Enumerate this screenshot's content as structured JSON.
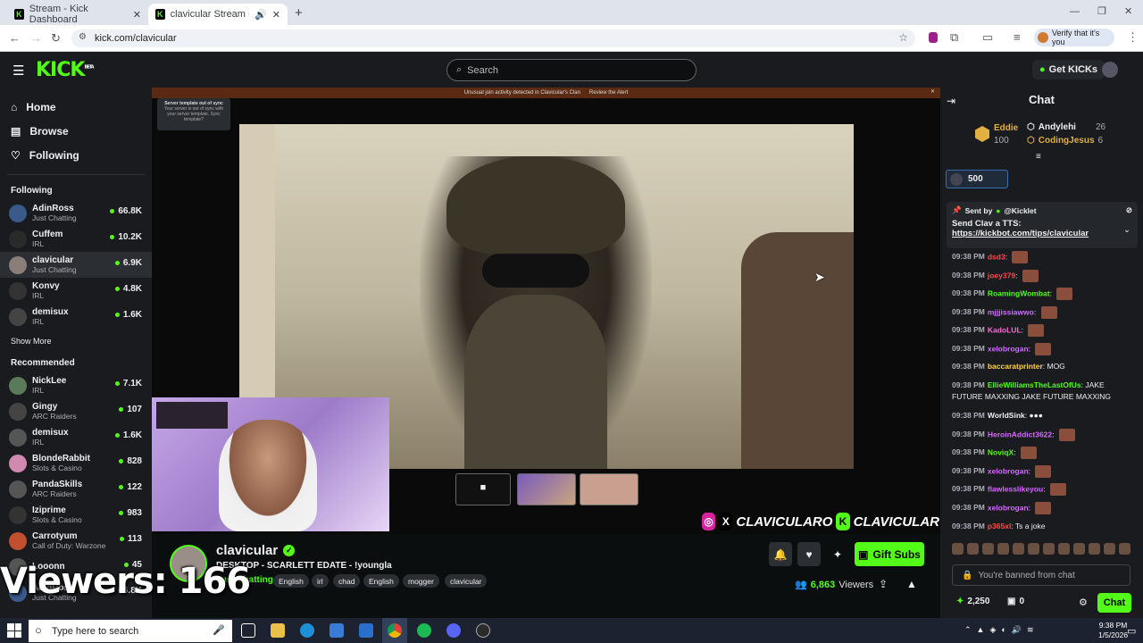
{
  "browser": {
    "tabs": [
      {
        "title": "Stream - Kick Dashboard"
      },
      {
        "title": "clavicular Stream - Watch L"
      }
    ],
    "url": "kick.com/clavicular",
    "verify_label": "Verify that it's you"
  },
  "topnav": {
    "logo": "KICK",
    "logo_badge": "BETA",
    "search_placeholder": "Search",
    "get_kicks_label": "Get KICKs"
  },
  "sidebar": {
    "nav": [
      {
        "label": "Home"
      },
      {
        "label": "Browse"
      },
      {
        "label": "Following"
      }
    ],
    "following_heading": "Following",
    "following": [
      {
        "name": "AdinRoss",
        "category": "Just Chatting",
        "viewers": "66.8K",
        "color": "#3a5a8a"
      },
      {
        "name": "Cuffem",
        "category": "IRL",
        "viewers": "10.2K",
        "color": "#2a2a2a"
      },
      {
        "name": "clavicular",
        "category": "Just Chatting",
        "viewers": "6.9K",
        "color": "#8a7f78"
      },
      {
        "name": "Konvy",
        "category": "IRL",
        "viewers": "4.8K",
        "color": "#333"
      },
      {
        "name": "demisux",
        "category": "IRL",
        "viewers": "1.6K",
        "color": "#444"
      }
    ],
    "show_more": "Show More",
    "recommended_heading": "Recommended",
    "recommended": [
      {
        "name": "NickLee",
        "category": "IRL",
        "viewers": "7.1K",
        "color": "#5a7a5a"
      },
      {
        "name": "Gingy",
        "category": "ARC Raiders",
        "viewers": "107",
        "color": "#444"
      },
      {
        "name": "demisux",
        "category": "IRL",
        "viewers": "1.6K",
        "color": "#555"
      },
      {
        "name": "BlondeRabbit",
        "category": "Slots & Casino",
        "viewers": "828",
        "color": "#d08ab0"
      },
      {
        "name": "PandaSkills",
        "category": "ARC Raiders",
        "viewers": "122",
        "color": "#555"
      },
      {
        "name": "Iziprime",
        "category": "Slots & Casino",
        "viewers": "983",
        "color": "#333"
      },
      {
        "name": "Carrotyum",
        "category": "Call of Duty: Warzone",
        "viewers": "113",
        "color": "#c05030"
      },
      {
        "name": "Looonn",
        "category": "",
        "viewers": "45",
        "color": "#555"
      },
      {
        "name": "AdinRoss",
        "category": "Just Chatting",
        "viewers": "66.8K",
        "color": "#3a5a8a"
      }
    ]
  },
  "video": {
    "alert_text": "Unusual join activity detected in Clavicular's Clan",
    "alert_action": "Review the Alert",
    "sync_title": "Server template out of sync",
    "sync_body": "Your server is out of sync with your server template. Sync template?",
    "social_handle_1": "CLAVICULARO",
    "social_handle_2": "CLAVICULAR"
  },
  "stream": {
    "name": "clavicular",
    "title": "DESKTOP - SCARLETT EDATE - !youngla",
    "category": "Just Chatting",
    "tags": [
      "English",
      "irl",
      "chad",
      "English",
      "mogger",
      "clavicular"
    ],
    "viewers": "6,863",
    "viewers_label": "Viewers",
    "gift_subs_label": "Gift Subs"
  },
  "overlay": {
    "viewers_text": "Viewers: 166"
  },
  "chat": {
    "title": "Chat",
    "gifters": [
      {
        "name": "Eddie",
        "amount": "100",
        "color": "#e0b040"
      },
      {
        "name": "Andylehi",
        "amount": "26",
        "color": "#efeff1"
      },
      {
        "name": "CodingJesus",
        "amount": "6",
        "color": "#e0b040"
      }
    ],
    "points_chip": "500",
    "pinned_sender": "@Kicklet",
    "pinned_sent_by": "Sent by",
    "pinned_line1": "Send Clav a TTS:",
    "pinned_link": "https://kickbot.com/tips/clavicular",
    "messages": [
      {
        "time": "09:38 PM",
        "user": "dsd3",
        "color": "#ff4a4a",
        "text": ""
      },
      {
        "time": "09:38 PM",
        "user": "joey379",
        "color": "#ff4a4a",
        "text": ""
      },
      {
        "time": "09:38 PM",
        "user": "RoamingWombat",
        "color": "#53fc18",
        "text": ""
      },
      {
        "time": "09:38 PM",
        "user": "mjjjissiawwo",
        "color": "#d46aff",
        "text": ""
      },
      {
        "time": "09:38 PM",
        "user": "KadoLUL",
        "color": "#ff6ad5",
        "text": ""
      },
      {
        "time": "09:38 PM",
        "user": "xelobrogan",
        "color": "#d46aff",
        "text": ""
      },
      {
        "time": "09:38 PM",
        "user": "baccaratprinter",
        "color": "#ffd34a",
        "text": "MOG"
      },
      {
        "time": "09:38 PM",
        "user": "EllieWilliamsTheLastOfUs",
        "color": "#53fc18",
        "text": "JAKE FUTURE MAXXING JAKE FUTURE MAXXING"
      },
      {
        "time": "09:38 PM",
        "user": "WorldSink",
        "color": "#efeff1",
        "text": "●●●"
      },
      {
        "time": "09:38 PM",
        "user": "HeroinAddict3622",
        "color": "#d46aff",
        "text": ""
      },
      {
        "time": "09:38 PM",
        "user": "NoviqX",
        "color": "#53fc18",
        "text": ""
      },
      {
        "time": "09:38 PM",
        "user": "xelobrogan",
        "color": "#d46aff",
        "text": ""
      },
      {
        "time": "09:38 PM",
        "user": "flawlesslikeyou",
        "color": "#d46aff",
        "text": ""
      },
      {
        "time": "09:38 PM",
        "user": "xelobrogan",
        "color": "#d46aff",
        "text": ""
      },
      {
        "time": "09:38 PM",
        "user": "p365xl",
        "color": "#ff4a4a",
        "text": "Ts a joke"
      }
    ],
    "banned_text": "You're banned from chat",
    "balance": "2,250",
    "balance2": "0",
    "chat_button": "Chat"
  },
  "taskbar": {
    "search_placeholder": "Type here to search",
    "time": "9:38 PM",
    "date": "1/5/2026"
  }
}
